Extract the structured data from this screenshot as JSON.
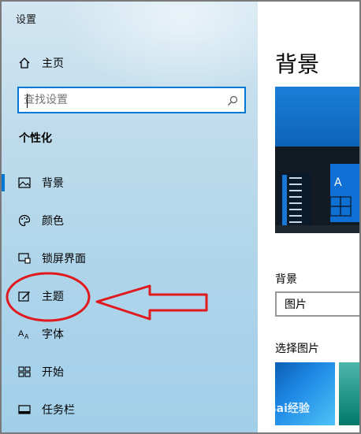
{
  "window": {
    "title": "设置"
  },
  "sidebar": {
    "home_label": "主页",
    "search": {
      "placeholder": "查找设置"
    },
    "section_title": "个性化",
    "items": [
      {
        "label": "背景",
        "icon": "image-icon",
        "active": true
      },
      {
        "label": "颜色",
        "icon": "palette-icon",
        "active": false
      },
      {
        "label": "锁屏界面",
        "icon": "lock-screen-icon",
        "active": false
      },
      {
        "label": "主题",
        "icon": "theme-icon",
        "active": false
      },
      {
        "label": "字体",
        "icon": "font-icon",
        "active": false
      },
      {
        "label": "开始",
        "icon": "start-icon",
        "active": false
      },
      {
        "label": "任务栏",
        "icon": "taskbar-icon",
        "active": false
      }
    ]
  },
  "main": {
    "page_title": "背景",
    "preview_tile_letter": "A",
    "background_label": "背景",
    "background_value": "图片",
    "choose_picture_label": "选择图片"
  },
  "watermark": "Bai经验",
  "colors": {
    "accent": "#0078d4",
    "annotation": "#e0191e"
  }
}
